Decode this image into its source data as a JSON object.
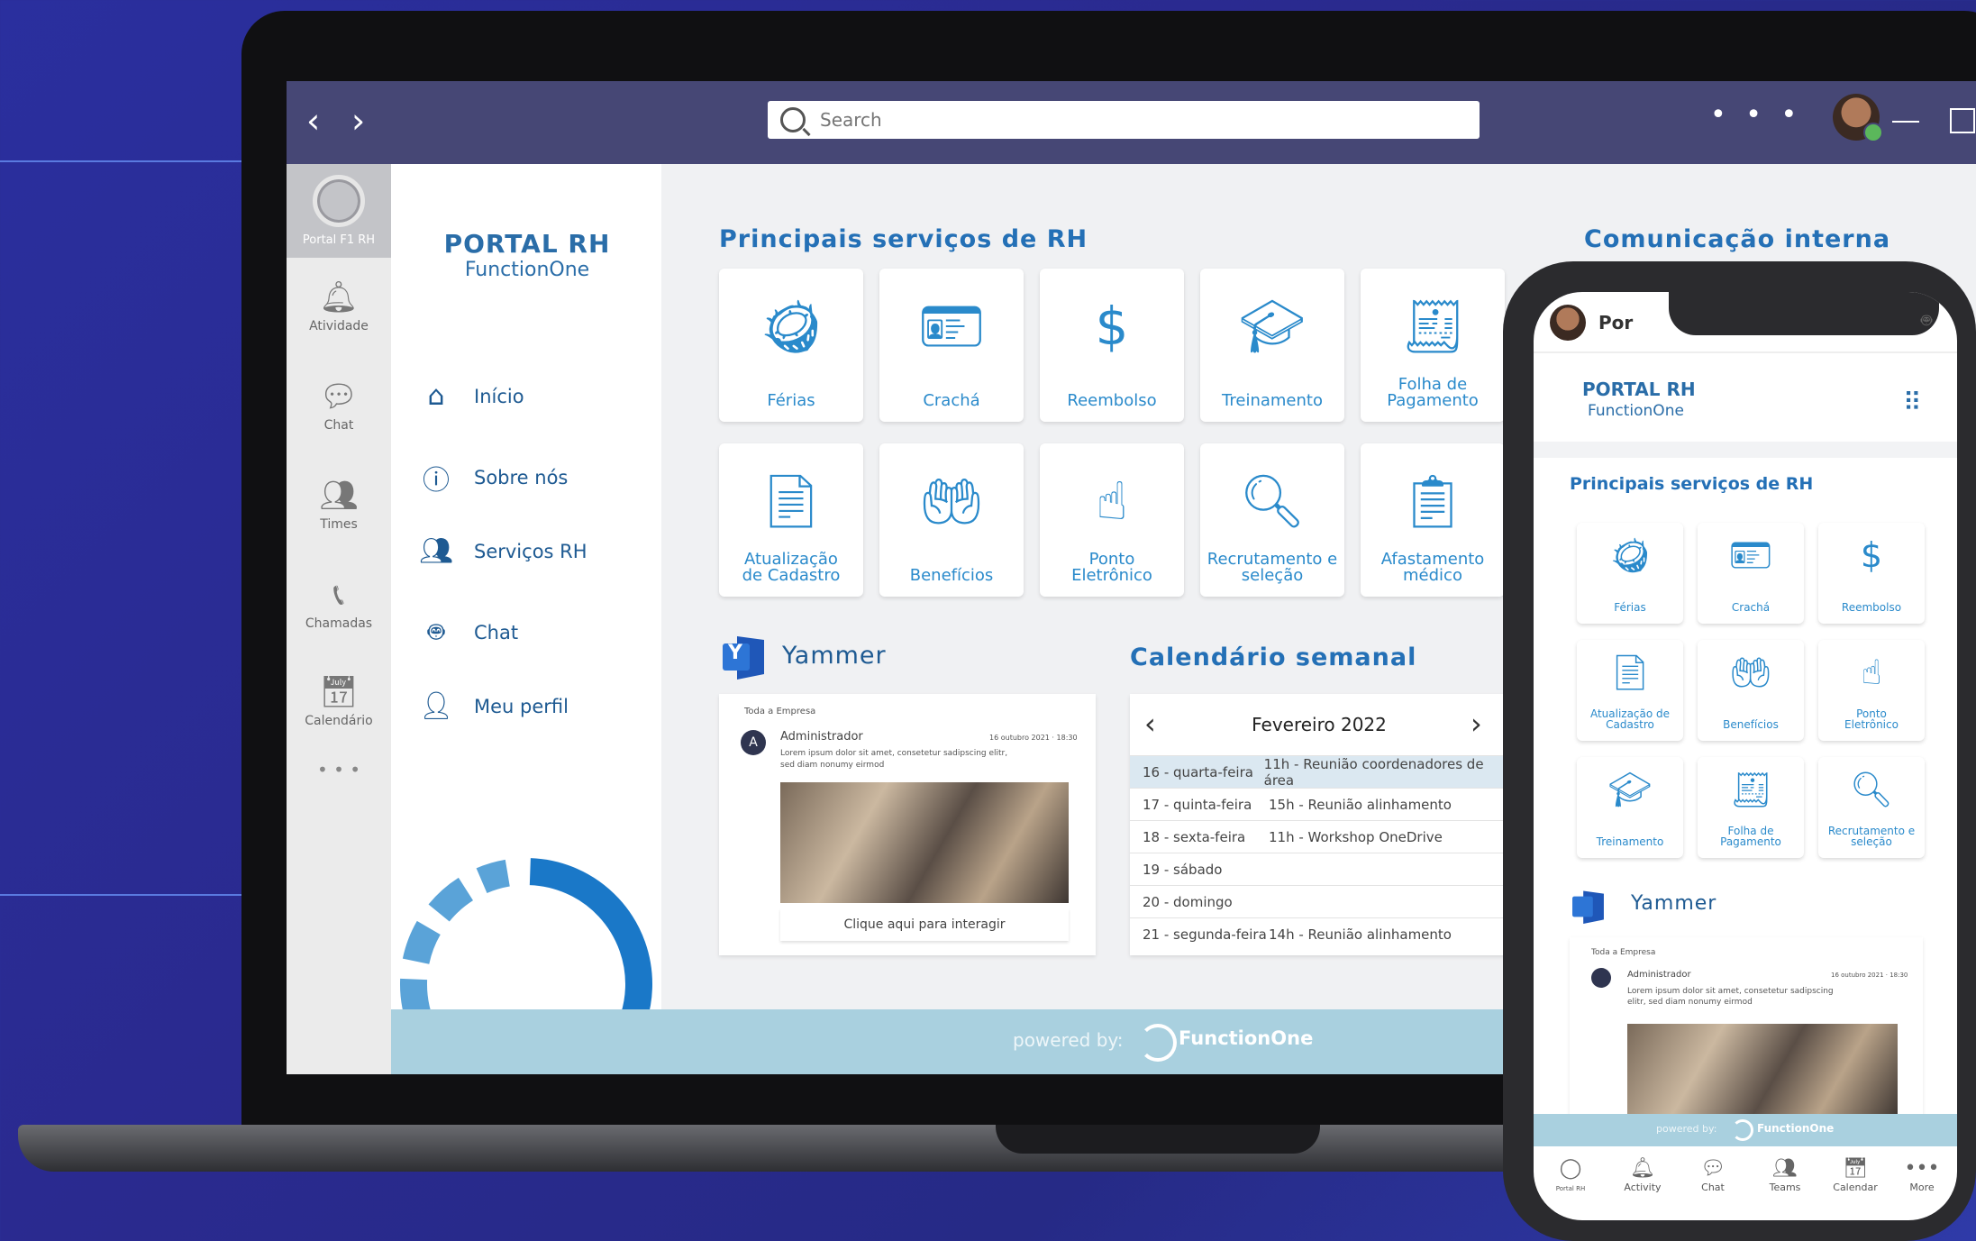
{
  "app": {
    "search_placeholder": "Search",
    "more_icon": "more-horizontal-icon",
    "nav_back_glyph": "‹",
    "nav_forward_glyph": "›",
    "more_glyph": "• • •"
  },
  "rail": {
    "items": [
      {
        "label": "Portal F1 RH",
        "icon": "portal-logo-icon",
        "active": true
      },
      {
        "label": "Atividade",
        "icon": "bell-icon"
      },
      {
        "label": "Chat",
        "icon": "chat-bubble-icon"
      },
      {
        "label": "Times",
        "icon": "teams-people-icon"
      },
      {
        "label": "Chamadas",
        "icon": "phone-icon"
      },
      {
        "label": "Calendário",
        "icon": "calendar-icon"
      }
    ],
    "more_glyph": "• • •"
  },
  "panel": {
    "brand_title": "PORTAL RH",
    "brand_subtitle": "FunctionOne",
    "menu": [
      {
        "label": "Início",
        "icon": "home-icon"
      },
      {
        "label": "Sobre nós",
        "icon": "info-icon"
      },
      {
        "label": "Serviços RH",
        "icon": "people-icon"
      },
      {
        "label": "Chat",
        "icon": "bot-icon"
      },
      {
        "label": "Meu perfil",
        "icon": "user-icon"
      }
    ]
  },
  "services": {
    "title": "Principais serviços de RH",
    "row1": [
      {
        "label": "Férias",
        "icon": "coconut-drink-icon"
      },
      {
        "label": "Crachá",
        "icon": "id-badge-icon"
      },
      {
        "label": "Reembolso",
        "icon": "dollar-coin-icon"
      },
      {
        "label": "Treinamento",
        "icon": "graduation-certificate-icon"
      },
      {
        "label": "Folha de Pagamento",
        "icon": "paycheck-icon"
      }
    ],
    "row2": [
      {
        "label": "Atualização de Cadastro",
        "icon": "document-info-icon"
      },
      {
        "label": "Benefícios",
        "icon": "hand-benefits-icon"
      },
      {
        "label": "Ponto Eletrônico",
        "icon": "fingerprint-touch-icon"
      },
      {
        "label": "Recrutamento e seleção",
        "icon": "search-person-icon"
      },
      {
        "label": "Afastamento médico",
        "icon": "medical-clipboard-icon"
      }
    ]
  },
  "communication": {
    "title": "Comunicação interna"
  },
  "yammer": {
    "title": "Yammer",
    "logo_letter": "Y",
    "group": "Toda a Empresa",
    "author": "Administrador",
    "author_initial": "A",
    "date": "16 outubro 2021 · 18:30",
    "text": "Lorem ipsum dolor sit amet, consetetur sadipscing elitr, sed diam nonumy eirmod",
    "cta": "Clique aqui para interagir"
  },
  "calendar": {
    "title": "Calendário semanal",
    "month": "Fevereiro 2022",
    "prev_glyph": "‹",
    "next_glyph": "›",
    "rows": [
      {
        "day": "16 - quarta-feira",
        "event": "11h - Reunião coordenadores de área",
        "highlight": true
      },
      {
        "day": "17 - quinta-feira",
        "event": "15h - Reunião alinhamento"
      },
      {
        "day": "18 - sexta-feira",
        "event": "11h - Workshop OneDrive"
      },
      {
        "day": "19 - sábado",
        "event": ""
      },
      {
        "day": "20 - domingo",
        "event": ""
      },
      {
        "day": "21 - segunda-feira",
        "event": "14h - Reunião alinhamento"
      }
    ]
  },
  "footer": {
    "powered": "powered by:",
    "brand": "FunctionOne"
  },
  "phone": {
    "header_title": "Por",
    "brand_title": "PORTAL RH",
    "brand_subtitle": "FunctionOne",
    "services_title": "Principais serviços de RH",
    "cards": [
      {
        "label": "Férias",
        "icon": "coconut-drink-icon"
      },
      {
        "label": "Crachá",
        "icon": "id-badge-icon"
      },
      {
        "label": "Reembolso",
        "icon": "dollar-coin-icon"
      },
      {
        "label": "Atualização de Cadastro",
        "icon": "document-info-icon"
      },
      {
        "label": "Benefícios",
        "icon": "hand-benefits-icon"
      },
      {
        "label": "Ponto Eletrônico",
        "icon": "fingerprint-touch-icon"
      },
      {
        "label": "Treinamento",
        "icon": "graduation-certificate-icon"
      },
      {
        "label": "Folha de Pagamento",
        "icon": "paycheck-icon"
      },
      {
        "label": "Recrutamento e seleção",
        "icon": "search-person-icon"
      }
    ],
    "yammer_title": "Yammer",
    "yammer_group": "Toda a Empresa",
    "yammer_author": "Administrador",
    "yammer_date": "16 outubro 2021 · 18:30",
    "yammer_text": "Lorem ipsum dolor sit amet, consetetur sadipscing elitr, sed diam nonumy eirmod",
    "footer_powered": "powered by:",
    "footer_brand": "FunctionOne",
    "tabs": [
      {
        "label": "Portal RH",
        "icon": "portal-logo-icon"
      },
      {
        "label": "Activity",
        "icon": "bell-icon"
      },
      {
        "label": "Chat",
        "icon": "chat-bubble-icon"
      },
      {
        "label": "Teams",
        "icon": "teams-people-icon"
      },
      {
        "label": "Calendar",
        "icon": "calendar-icon"
      },
      {
        "label": "More",
        "icon": "more-horizontal-icon"
      }
    ]
  },
  "colors": {
    "topbar": "#464775",
    "accent": "#2470b6",
    "icon": "#2a8acb",
    "footer": "#a9d0df",
    "highlight": "#dbe8f1"
  }
}
